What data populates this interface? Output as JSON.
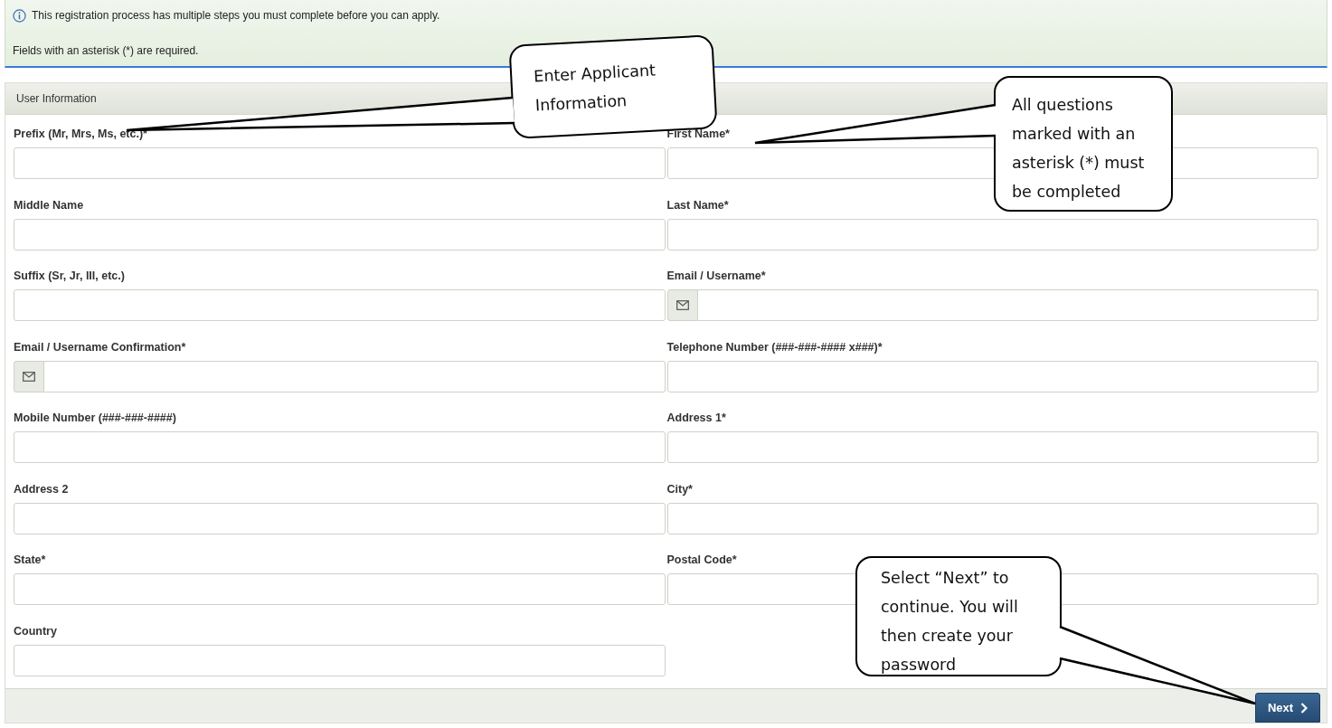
{
  "banner": {
    "lines": [
      "This registration process has multiple steps you must complete before you can apply.",
      "Fields with an asterisk (*) are required."
    ]
  },
  "panel": {
    "title": "User Information"
  },
  "fields": [
    {
      "label": "Prefix (Mr, Mrs, Ms, etc.)*",
      "kind": "text"
    },
    {
      "label": "First Name*",
      "kind": "text"
    },
    {
      "label": "Middle Name",
      "kind": "text"
    },
    {
      "label": "Last Name*",
      "kind": "text"
    },
    {
      "label": "Suffix (Sr, Jr, III, etc.)",
      "kind": "text"
    },
    {
      "label": "Email / Username*",
      "kind": "email"
    },
    {
      "label": "Email / Username Confirmation*",
      "kind": "email"
    },
    {
      "label": "Telephone Number (###-###-#### x###)*",
      "kind": "text"
    },
    {
      "label": "Mobile Number (###-###-####)",
      "kind": "text"
    },
    {
      "label": "Address 1*",
      "kind": "text"
    },
    {
      "label": "Address 2",
      "kind": "text"
    },
    {
      "label": "City*",
      "kind": "text"
    },
    {
      "label": "State*",
      "kind": "text"
    },
    {
      "label": "Postal Code*",
      "kind": "text"
    },
    {
      "label": "Country",
      "kind": "text"
    }
  ],
  "footer": {
    "next_button": "Next"
  },
  "callouts": [
    {
      "text": "Enter Applicant Information"
    },
    {
      "text": "All questions marked with an asterisk (*) must be completed"
    },
    {
      "text": "Select “Next” to continue. You will then create your password"
    }
  ]
}
